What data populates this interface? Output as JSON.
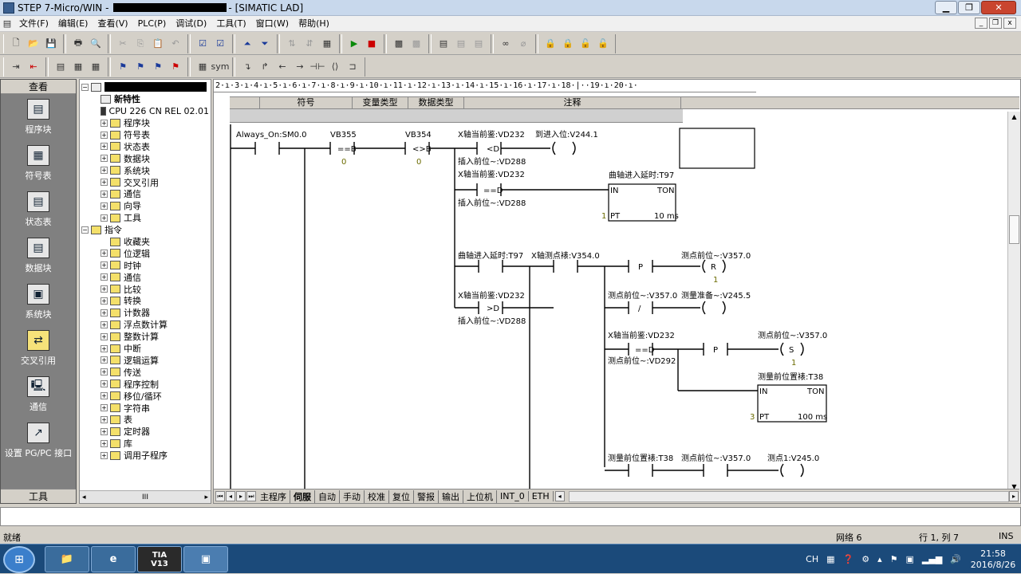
{
  "window": {
    "title_prefix": "STEP 7-Micro/WIN -",
    "title_suffix": "- [SIMATIC LAD]"
  },
  "menu": [
    "文件(F)",
    "编辑(E)",
    "查看(V)",
    "PLC(P)",
    "调试(D)",
    "工具(T)",
    "窗口(W)",
    "帮助(H)"
  ],
  "nav": {
    "header": "查看",
    "footer": "工具",
    "items": [
      "程序块",
      "符号表",
      "状态表",
      "数据块",
      "系统块",
      "交叉引用",
      "通信",
      "设置 PG/PC 接口"
    ]
  },
  "tree": {
    "features": "新特性",
    "cpu": "CPU 226 CN REL 02.01",
    "project_items": [
      "程序块",
      "符号表",
      "状态表",
      "数据块",
      "系统块",
      "交叉引用",
      "通信",
      "向导",
      "工具"
    ],
    "instructions": "指令",
    "instruction_items": [
      "收藏夹",
      "位逻辑",
      "时钟",
      "通信",
      "比较",
      "转换",
      "计数器",
      "浮点数计算",
      "整数计算",
      "中断",
      "逻辑运算",
      "传送",
      "程序控制",
      "移位/循环",
      "字符串",
      "表",
      "定时器",
      "库",
      "调用子程序"
    ],
    "scroll_mid": "III"
  },
  "ruler": "2·ı·3·ı·4·ı·5·ı·6·ı·7·ı·8·ı·9·ı·10·ı·11·ı·12·ı·13·ı·14·ı·15·ı·16·ı·17·ı·18·|··19·ı·20·ı·",
  "symbol_table": {
    "headers": [
      "符号",
      "变量类型",
      "数据类型",
      "注释"
    ]
  },
  "ladder": {
    "always_on": "Always_On:SM0.0",
    "vb355": "VB355",
    "eqb": "==B",
    "zero": "0",
    "vb354": "VB354",
    "neb": "<>B",
    "x_pos": "X轴当前鉴:VD232",
    "ltd": "<D",
    "ins_pos": "插入前位~:VD288",
    "arrive": "到进入位:V244.1",
    "eqd": "==D",
    "curve_delay": "曲轴进入延时:T97",
    "in": "IN",
    "ton": "TON",
    "pt": "PT",
    "one": "1",
    "ms10": "10 ms",
    "x_measure": "X轴测点裱:V354.0",
    "p": "P",
    "meas_pos": "测点前位~:V357.0",
    "r": "R",
    "gtd": ">D",
    "slash": "/",
    "meas_ready": "测量准备~:V245.5",
    "meas_pos2": "测点前位~:VD292",
    "s": "S",
    "meas_delay": "测量前位置裱:T38",
    "three": "3",
    "ms100": "100 ms",
    "meas1": "测点1:V245.0"
  },
  "tabs": [
    "主程序",
    "伺服",
    "自动",
    "手动",
    "校准",
    "复位",
    "警报",
    "输出",
    "上位机",
    "INT_0",
    "ETH"
  ],
  "status": {
    "ready": "就绪",
    "network": "网络 6",
    "rowcol": "行 1, 列 7",
    "ins": "INS"
  },
  "taskbar": {
    "tia": "TIA\nV13",
    "lang": "CH",
    "time": "21:58",
    "date": "2016/8/26"
  }
}
